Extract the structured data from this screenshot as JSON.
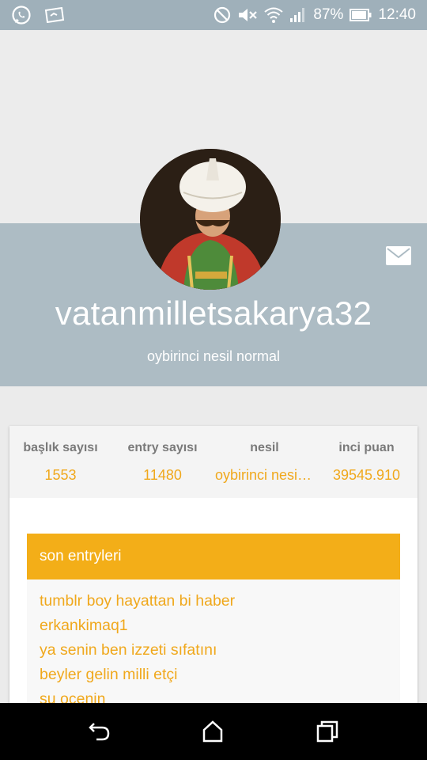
{
  "status_bar": {
    "battery": "87%",
    "time": "12:40",
    "icons": [
      "whatsapp-icon",
      "game-controller-icon",
      "do-not-disturb-icon",
      "mute-icon",
      "wifi-icon",
      "signal-icon",
      "battery-icon"
    ]
  },
  "profile": {
    "username": "vatanmilletsakarya32",
    "generation_subtitle": "oybirinci nesil normal",
    "avatar": "avatar-portrait",
    "message_icon": "envelope-icon"
  },
  "stats": [
    {
      "label": "başlık sayısı",
      "value": "1553"
    },
    {
      "label": "entry sayısı",
      "value": "11480"
    },
    {
      "label": "nesil",
      "value": "oybirinci nesil normal"
    },
    {
      "label": "inci puan",
      "value": "39545.910"
    }
  ],
  "entries": {
    "title": "son entryleri",
    "items": [
      "tumblr boy hayattan bi haber",
      "erkankimaq1",
      "ya senin ben izzeti sıfatını",
      "beyler gelin milli etçi",
      "şu ocenin"
    ]
  },
  "nav": [
    "back-icon",
    "home-icon",
    "recents-icon"
  ],
  "colors": {
    "accent": "#f3ae18",
    "band": "#adbcc4",
    "status_bar": "#9fb0ba"
  }
}
